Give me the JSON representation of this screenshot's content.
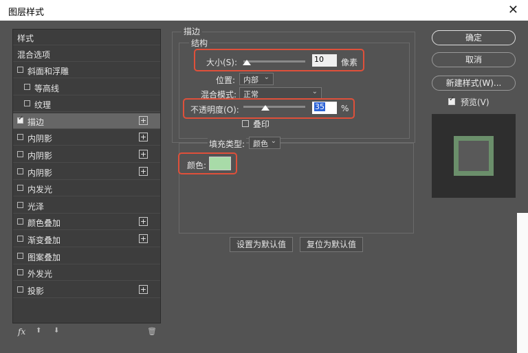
{
  "window": {
    "title": "图层样式",
    "close_glyph": "✕"
  },
  "sidebar": {
    "header": "样式",
    "blend_options": "混合选项",
    "items": [
      {
        "label": "斜面和浮雕",
        "checked": false,
        "has_plus": false,
        "indent": false
      },
      {
        "label": "等高线",
        "checked": false,
        "has_plus": false,
        "indent": true
      },
      {
        "label": "纹理",
        "checked": false,
        "has_plus": false,
        "indent": true
      },
      {
        "label": "描边",
        "checked": true,
        "has_plus": true,
        "indent": false
      },
      {
        "label": "内阴影",
        "checked": false,
        "has_plus": true,
        "indent": false
      },
      {
        "label": "内阴影",
        "checked": false,
        "has_plus": true,
        "indent": false
      },
      {
        "label": "内阴影",
        "checked": false,
        "has_plus": true,
        "indent": false
      },
      {
        "label": "内发光",
        "checked": false,
        "has_plus": false,
        "indent": false
      },
      {
        "label": "光泽",
        "checked": false,
        "has_plus": false,
        "indent": false
      },
      {
        "label": "颜色叠加",
        "checked": false,
        "has_plus": true,
        "indent": false
      },
      {
        "label": "渐变叠加",
        "checked": false,
        "has_plus": true,
        "indent": false
      },
      {
        "label": "图案叠加",
        "checked": false,
        "has_plus": false,
        "indent": false
      },
      {
        "label": "外发光",
        "checked": false,
        "has_plus": false,
        "indent": false
      },
      {
        "label": "投影",
        "checked": false,
        "has_plus": true,
        "indent": false
      }
    ],
    "plus_glyph": "+",
    "bottom": {
      "fx": "fx",
      "up": "⬆",
      "down": "⬇",
      "trash": "🗑"
    }
  },
  "stroke": {
    "section_title": "描边",
    "structure_title": "结构",
    "size_label": "大小(S):",
    "size_value": "10",
    "size_unit": "像素",
    "size_fraction": 0.05,
    "position_label": "位置:",
    "position_value": "内部",
    "blend_label": "混合模式:",
    "blend_value": "正常",
    "opacity_label": "不透明度(O):",
    "opacity_value": "35",
    "opacity_unit": "%",
    "opacity_fraction": 0.35,
    "overprint_label": "叠印",
    "fill_type_label": "填充类型:",
    "fill_type_value": "颜色",
    "color_label": "颜色:",
    "color_value": "#a8dba8",
    "set_default": "设置为默认值",
    "reset_default": "复位为默认值"
  },
  "buttons": {
    "ok": "确定",
    "cancel": "取消",
    "new_style": "新建样式(W)...",
    "preview_label": "预览(V)",
    "preview_checked": true
  },
  "colors": {
    "highlight": "#e0503a",
    "stroke_preview": "#6b8f6b"
  }
}
